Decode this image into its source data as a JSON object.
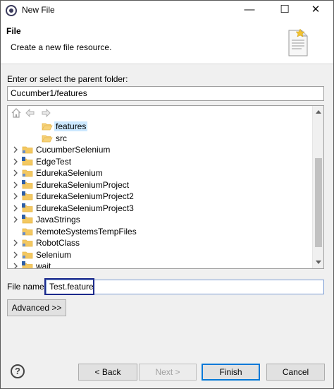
{
  "window": {
    "title": "New File",
    "minimize_glyph": "—",
    "maximize_glyph": "☐",
    "close_glyph": "✕"
  },
  "header": {
    "title": "File",
    "description": "Create a new file resource."
  },
  "parent_folder": {
    "label": "Enter or select the parent folder:",
    "value": "Cucumber1/features"
  },
  "tree": {
    "toolbar_icons": [
      "home-icon",
      "back-arrow-icon",
      "forward-arrow-icon"
    ],
    "items": [
      {
        "label": "features",
        "expandable": false,
        "indent": 1,
        "selected": true,
        "icon": "open-folder-icon"
      },
      {
        "label": "src",
        "expandable": false,
        "indent": 1,
        "selected": false,
        "icon": "open-folder-icon"
      },
      {
        "label": "CucumberSelenium",
        "expandable": true,
        "indent": 0,
        "selected": false,
        "icon": "project-folder-icon"
      },
      {
        "label": "EdgeTest",
        "expandable": true,
        "indent": 0,
        "selected": false,
        "icon": "java-project-icon"
      },
      {
        "label": "EdurekaSelenium",
        "expandable": true,
        "indent": 0,
        "selected": false,
        "icon": "project-folder-icon"
      },
      {
        "label": "EdurekaSeleniumProject",
        "expandable": true,
        "indent": 0,
        "selected": false,
        "icon": "java-project-icon"
      },
      {
        "label": "EdurekaSeleniumProject2",
        "expandable": true,
        "indent": 0,
        "selected": false,
        "icon": "java-project-icon"
      },
      {
        "label": "EdurekaSeleniumProject3",
        "expandable": true,
        "indent": 0,
        "selected": false,
        "icon": "java-project-icon"
      },
      {
        "label": "JavaStrings",
        "expandable": true,
        "indent": 0,
        "selected": false,
        "icon": "java-project-icon"
      },
      {
        "label": "RemoteSystemsTempFiles",
        "expandable": false,
        "indent": 0,
        "selected": false,
        "icon": "project-folder-icon"
      },
      {
        "label": "RobotClass",
        "expandable": true,
        "indent": 0,
        "selected": false,
        "icon": "project-folder-icon"
      },
      {
        "label": "Selenium",
        "expandable": true,
        "indent": 0,
        "selected": false,
        "icon": "project-folder-icon"
      },
      {
        "label": "wait",
        "expandable": true,
        "indent": 0,
        "selected": false,
        "icon": "java-project-icon"
      }
    ]
  },
  "file_name": {
    "label": "File name:",
    "value": "Test.feature"
  },
  "buttons": {
    "advanced": "Advanced >>",
    "back": "< Back",
    "next": "Next >",
    "finish": "Finish",
    "cancel": "Cancel",
    "help": "?"
  },
  "colors": {
    "accent": "#0078d7",
    "highlight_box": "#1c2a8c",
    "selection": "#cce8ff",
    "folder": "#e8b64a"
  }
}
